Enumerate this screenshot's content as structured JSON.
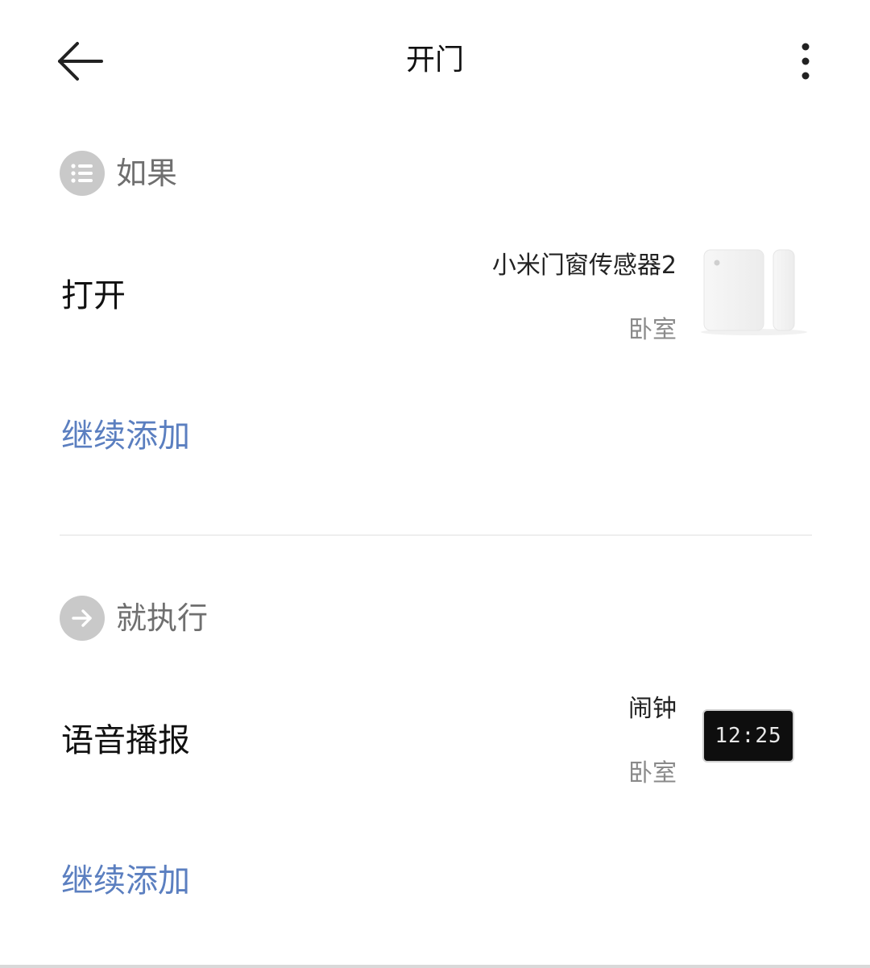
{
  "header": {
    "title": "开门",
    "back_icon": "arrow-left-icon",
    "more_icon": "more-vertical-icon"
  },
  "if_section": {
    "label": "如果",
    "icon": "list-icon",
    "condition": {
      "title": "打开",
      "device_name": "小米门窗传感器2",
      "room": "卧室",
      "device_image": "door-window-sensor"
    },
    "add_more": "继续添加"
  },
  "then_section": {
    "label": "就执行",
    "icon": "arrow-right-icon",
    "action": {
      "title": "语音播报",
      "device_name": "闹钟",
      "room": "卧室",
      "device_image": "alarm-clock",
      "clock_display": "12:25"
    },
    "add_more": "继续添加"
  },
  "colors": {
    "link": "#5b7fc0",
    "section_icon_bg": "#c9c9c9",
    "section_label": "#6f6f6f",
    "secondary_text": "#8a8a8a"
  }
}
